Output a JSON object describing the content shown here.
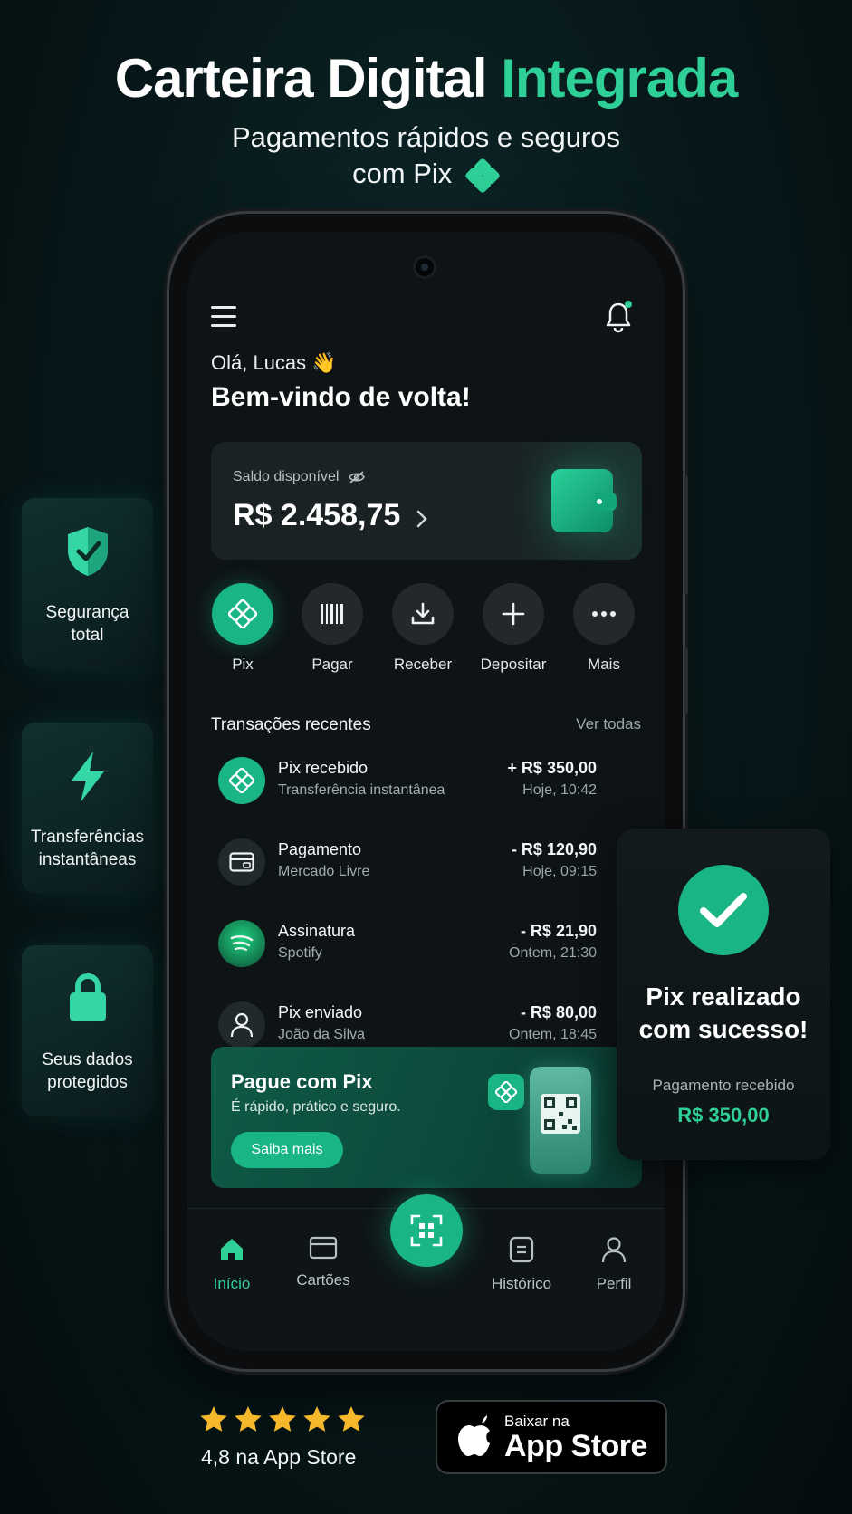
{
  "header": {
    "title_main": "Carteira Digital",
    "title_accent": "Integrada",
    "subtitle_line1": "Pagamentos rápidos e seguros",
    "subtitle_line2": "com Pix"
  },
  "badges": [
    {
      "label": "Segurança total",
      "line1": "Segurança",
      "line2": "total",
      "icon": "shield-icon"
    },
    {
      "label": "Transferências instantâneas",
      "line1": "Transferências",
      "line2": "instantâneas",
      "icon": "lightning-icon"
    },
    {
      "label": "Seus dados protegidos",
      "line1": "Seus dados",
      "line2": "protegidos",
      "icon": "lock-icon"
    }
  ],
  "app": {
    "greeting": "Olá, Lucas 👋",
    "welcome": "Bem-vindo de volta!",
    "balance": {
      "label": "Saldo disponível",
      "value": "R$ 2.458,75"
    },
    "actions": [
      {
        "label": "Pix",
        "icon": "pix-icon"
      },
      {
        "label": "Pagar",
        "icon": "barcode-icon"
      },
      {
        "label": "Receber",
        "icon": "download-icon"
      },
      {
        "label": "Depositar",
        "icon": "plus-icon"
      },
      {
        "label": "Mais",
        "icon": "more-icon"
      }
    ],
    "transactions_title": "Transações recentes",
    "see_all": "Ver todas",
    "transactions": [
      {
        "name": "Pix recebido",
        "desc": "Transferência instantânea",
        "amount": "+ R$ 350,00",
        "date": "Hoje, 10:42",
        "icon": "pix-icon"
      },
      {
        "name": "Pagamento",
        "desc": "Mercado Livre",
        "amount": "- R$ 120,90",
        "date": "Hoje, 09:15",
        "icon": "card-icon"
      },
      {
        "name": "Assinatura",
        "desc": "Spotify",
        "amount": "- R$ 21,90",
        "date": "Ontem, 21:30",
        "icon": "spotify-icon"
      },
      {
        "name": "Pix enviado",
        "desc": "João da Silva",
        "amount": "- R$ 80,00",
        "date": "Ontem, 18:45",
        "icon": "user-icon"
      }
    ],
    "promo": {
      "title": "Pague com Pix",
      "desc": "É rápido, prático e seguro.",
      "button": "Saiba mais"
    },
    "nav": [
      {
        "label": "Início",
        "icon": "home-icon"
      },
      {
        "label": "Cartões",
        "icon": "card-icon"
      },
      {
        "label": "Histórico",
        "icon": "history-icon"
      },
      {
        "label": "Perfil",
        "icon": "user-icon"
      }
    ],
    "colors": {
      "accent": "#2fcf98",
      "primary": "#19b585"
    }
  },
  "success_popup": {
    "title_line1": "Pix realizado",
    "title_line2": "com sucesso!",
    "label": "Pagamento recebido",
    "amount": "R$ 350,00"
  },
  "footer": {
    "rating": "4,8 na App Store",
    "stars": 5,
    "store_small": "Baixar na",
    "store_big": "App Store"
  }
}
